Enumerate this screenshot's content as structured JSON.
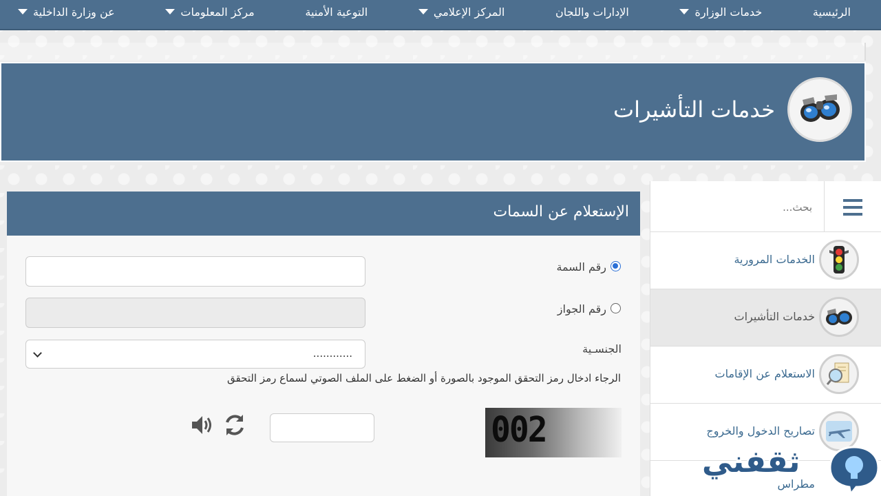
{
  "nav": {
    "items": [
      {
        "label": "الرئيسية",
        "has_dropdown": false
      },
      {
        "label": "خدمات الوزارة",
        "has_dropdown": true
      },
      {
        "label": "الإدارات واللجان",
        "has_dropdown": false
      },
      {
        "label": "المركز الإعلامي",
        "has_dropdown": true
      },
      {
        "label": "التوعية الأمنية",
        "has_dropdown": false
      },
      {
        "label": "مركز المعلومات",
        "has_dropdown": true
      },
      {
        "label": "عن وزارة الداخلية",
        "has_dropdown": true
      }
    ]
  },
  "banner": {
    "title": "خدمات التأشيرات",
    "icon": "binoculars-icon"
  },
  "sidebar": {
    "search_placeholder": "بحث...",
    "items": [
      {
        "label": "الخدمات المرورية",
        "icon": "traffic-light-icon",
        "active": false
      },
      {
        "label": "خدمات التأشيرات",
        "icon": "binoculars-icon",
        "active": true
      },
      {
        "label": "الاستعلام عن الإقامات",
        "icon": "magnifier-document-icon",
        "active": false
      },
      {
        "label": "تصاريح الدخول والخروج",
        "icon": "airplane-icon",
        "active": false
      },
      {
        "label": "مطراس",
        "icon": "",
        "active": false
      }
    ]
  },
  "form": {
    "title": "الإستعلام عن السمات",
    "option_visa_number": "رقم السمة",
    "option_passport_number": "رقم الجواز",
    "selected_option": "visa_number",
    "nationality_label": "الجنسـية",
    "nationality_value": "............",
    "captcha_hint": "الرجاء ادخال رمز التحقق الموجود بالصورة أو الضغط على الملف الصوتي لسماع رمز التحقق",
    "captcha_code": "002"
  },
  "watermark": {
    "text": "ثقفني"
  },
  "colors": {
    "primary": "#4d6f8f",
    "link": "#3b6a90",
    "radio_accent": "#2a6fd6"
  }
}
